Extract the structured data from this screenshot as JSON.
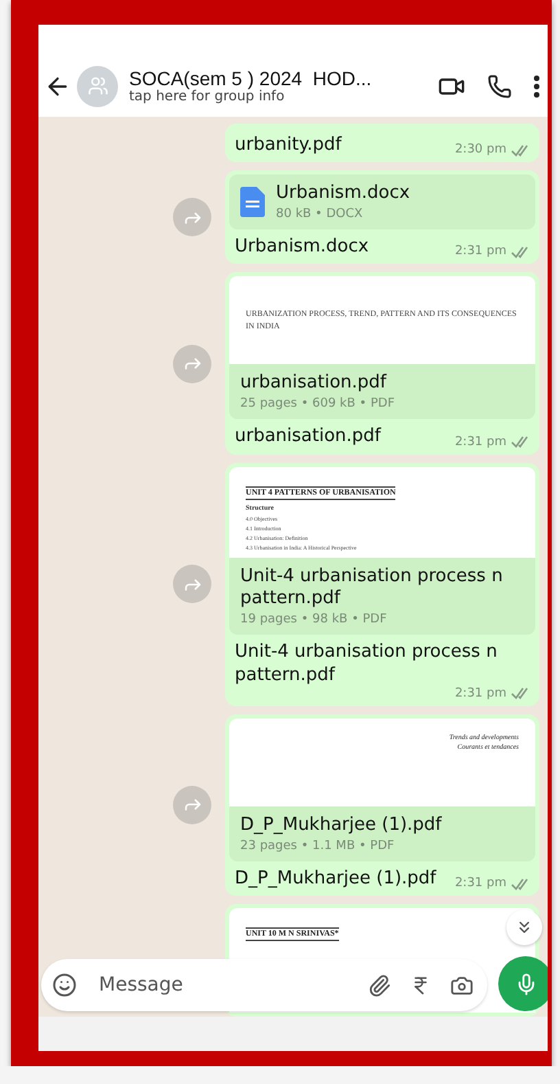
{
  "header": {
    "title": "SOCA(sem 5 ) 2024  HOD...",
    "subtitle": "tap here for group info"
  },
  "messages": [
    {
      "forward": false,
      "caption": "urbanity.pdf",
      "time": "2:30 pm",
      "read": false
    },
    {
      "forward": true,
      "file": {
        "kind": "docx",
        "name": "Urbanism.docx",
        "meta": "80 kB • DOCX"
      },
      "caption": "Urbanism.docx",
      "time": "2:31 pm",
      "read": false
    },
    {
      "forward": true,
      "preview": {
        "lines": [
          {
            "kind": "plain_title",
            "text": "URBANIZATION PROCESS, TREND, PATTERN AND ITS CONSEQUENCES IN INDIA"
          }
        ]
      },
      "file": {
        "kind": "pdf",
        "name": "urbanisation.pdf",
        "meta": "25 pages • 609 kB • PDF"
      },
      "caption": "urbanisation.pdf",
      "time": "2:31 pm",
      "read": false
    },
    {
      "forward": true,
      "preview": {
        "lines": [
          {
            "kind": "title",
            "text": "UNIT 4   PATTERNS OF URBANISATION"
          },
          {
            "kind": "section",
            "text": "Structure"
          },
          {
            "kind": "item",
            "text": "4.0   Objectives"
          },
          {
            "kind": "item",
            "text": "4.1   Introduction"
          },
          {
            "kind": "item",
            "text": "4.2   Urbanisation: Definition"
          },
          {
            "kind": "item",
            "text": "4.3   Urbanisation in India: A Historical Perspective"
          }
        ]
      },
      "file": {
        "kind": "pdf",
        "name": "Unit-4 urbanisation process n pattern.pdf",
        "meta": "19 pages • 98 kB • PDF"
      },
      "caption": "Unit-4 urbanisation process n pattern.pdf",
      "time": "2:31 pm",
      "read": false
    },
    {
      "forward": true,
      "preview": {
        "lines": [
          {
            "kind": "right_italic",
            "text": "Trends and developments"
          },
          {
            "kind": "right_italic",
            "text": "Courants et tendances"
          }
        ]
      },
      "file": {
        "kind": "pdf",
        "name": "D_P_Mukharjee (1).pdf",
        "meta": "23 pages • 1.1 MB • PDF"
      },
      "caption": "D_P_Mukharjee (1).pdf",
      "time": "2:31 pm",
      "read": false
    },
    {
      "forward": false,
      "preview": {
        "lines": [
          {
            "kind": "title",
            "text": "UNIT 10 M N SRINIVAS*"
          }
        ]
      }
    }
  ],
  "composer": {
    "placeholder": "Message"
  }
}
